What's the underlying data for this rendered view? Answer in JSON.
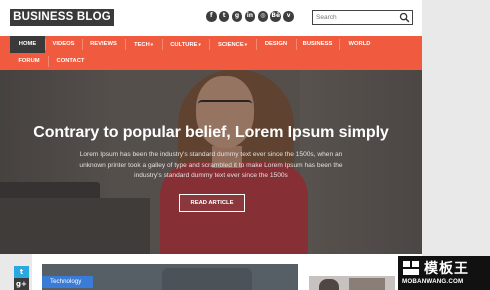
{
  "header": {
    "logo": "BUSINESS BLOG",
    "social_icons": [
      {
        "name": "facebook-icon",
        "glyph": "f"
      },
      {
        "name": "twitter-icon",
        "glyph": "t"
      },
      {
        "name": "google-plus-icon",
        "glyph": "g"
      },
      {
        "name": "linkedin-icon",
        "glyph": "in"
      },
      {
        "name": "instagram-icon",
        "glyph": "◎"
      },
      {
        "name": "behance-icon",
        "glyph": "Bē"
      },
      {
        "name": "vimeo-icon",
        "glyph": "v"
      }
    ],
    "search": {
      "placeholder": "Search"
    }
  },
  "nav": {
    "row1": [
      {
        "label": "HOME",
        "active": true
      },
      {
        "label": "VIDEOS"
      },
      {
        "label": "REVIEWS"
      },
      {
        "label": "TECH",
        "dropdown": true
      },
      {
        "label": "CULTURE",
        "dropdown": true
      },
      {
        "label": "SCIENCE",
        "dropdown": true
      },
      {
        "label": "DESIGN"
      },
      {
        "label": "BUSINESS"
      },
      {
        "label": "WORLD"
      }
    ],
    "row2": [
      {
        "label": "FORUM"
      },
      {
        "label": "CONTACT"
      }
    ]
  },
  "hero": {
    "title": "Contrary to popular belief, Lorem Ipsum simply",
    "text": "Lorem Ipsum has been the industry's standard dummy text ever since the 1500s, when an unknown printer took a galley of type and scrambled it to make Lorem Ipsum has been the industry's standard dummy text ever since the 1500s",
    "button": "READ ARTICLE"
  },
  "post": {
    "tag": "Technology"
  },
  "share": {
    "twitter": "t",
    "google_plus": "g+"
  },
  "watermark": {
    "cn": "模板王",
    "en": "MOBANWANG.COM"
  },
  "colors": {
    "nav": "#f05a3e",
    "active": "#3a3a3a",
    "tag": "#3b7bd8"
  }
}
